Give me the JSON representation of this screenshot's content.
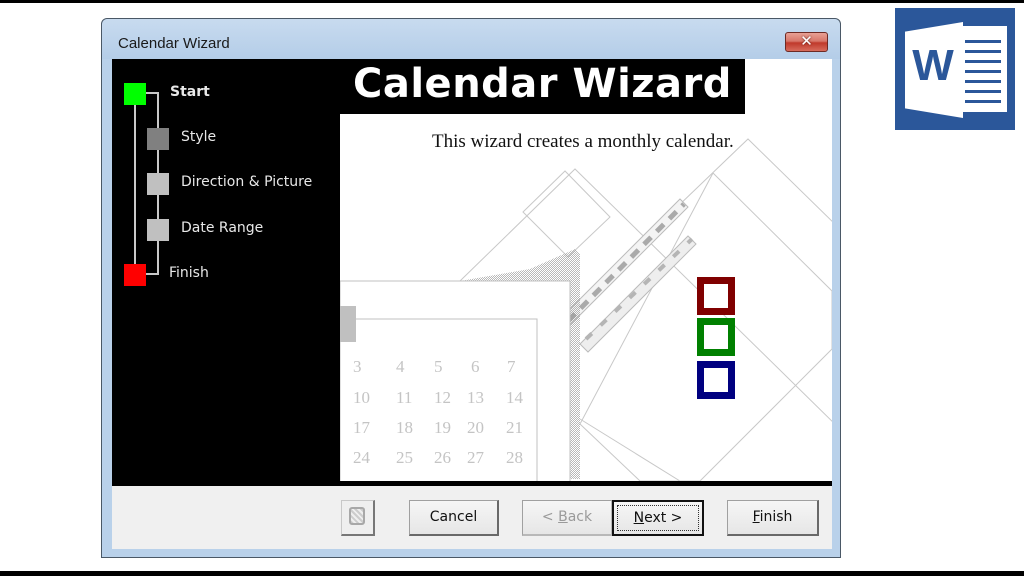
{
  "window": {
    "title": "Calendar Wizard",
    "close_glyph": "✕"
  },
  "sidebar": {
    "steps": [
      {
        "label": "Start",
        "state": "current",
        "color": "#00ff00"
      },
      {
        "label": "Style",
        "state": "pending",
        "color": "#808080"
      },
      {
        "label": "Direction & Picture",
        "state": "pending",
        "color": "#c0c0c0"
      },
      {
        "label": "Date Range",
        "state": "pending",
        "color": "#c0c0c0"
      },
      {
        "label": "Finish",
        "state": "end",
        "color": "#ff0000"
      }
    ]
  },
  "main": {
    "banner_title": "Calendar Wizard",
    "description": "This wizard creates a monthly calendar.",
    "preview_calendar": {
      "rows": [
        [
          "3",
          "4",
          "5",
          "6",
          "7"
        ],
        [
          "10",
          "11",
          "12",
          "13",
          "14"
        ],
        [
          "17",
          "18",
          "19",
          "20",
          "21"
        ],
        [
          "24",
          "25",
          "26",
          "27",
          "28"
        ]
      ]
    },
    "color_swatches": [
      "#800000",
      "#008000",
      "#000080"
    ]
  },
  "buttons": {
    "help_icon": "office-assistant-icon",
    "cancel": "Cancel",
    "back_prefix": "< ",
    "back_accel": "B",
    "back_rest": "ack",
    "next_accel": "N",
    "next_rest": "ext >",
    "finish_accel": "F",
    "finish_rest": "inish"
  },
  "branding": {
    "app_logo": "microsoft-word-logo",
    "logo_letter": "W",
    "logo_color": "#2b579a"
  }
}
